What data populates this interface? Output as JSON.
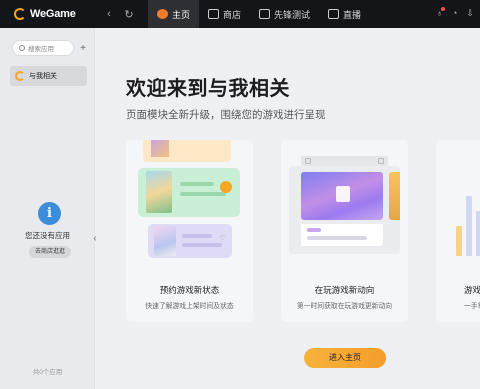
{
  "titlebar": {
    "app_name": "WeGame",
    "tabs": [
      {
        "label": "主页",
        "icon": "home-icon",
        "active": true
      },
      {
        "label": "商店",
        "icon": "store-icon",
        "active": false
      },
      {
        "label": "先锋测试",
        "icon": "test-icon",
        "active": false
      },
      {
        "label": "直播",
        "icon": "live-icon",
        "active": false
      }
    ]
  },
  "sidebar": {
    "search_placeholder": "搜索应用",
    "add": "+",
    "items": [
      {
        "label": "与我相关",
        "icon": "wegame-icon"
      }
    ],
    "empty_icon": "i",
    "empty_text": "您还没有应用",
    "store_button": "去商店逛逛",
    "app_count": "共0个应用"
  },
  "main": {
    "title": "欢迎来到与我相关",
    "subtitle": "页面模块全新升级，围绕您的游戏进行呈现",
    "cards": [
      {
        "title": "预约游戏新状态",
        "desc": "快速了解游戏上架时间及状态"
      },
      {
        "title": "在玩游戏新动向",
        "desc": "第一时间获取在玩游戏更新动向"
      },
      {
        "title": "游戏",
        "desc": "一手掌握个"
      }
    ],
    "enter_button": "进入主页"
  },
  "colors": {
    "accent": "#f5a623",
    "titlebar": "#141518",
    "info_blue": "#3c8ddb"
  }
}
